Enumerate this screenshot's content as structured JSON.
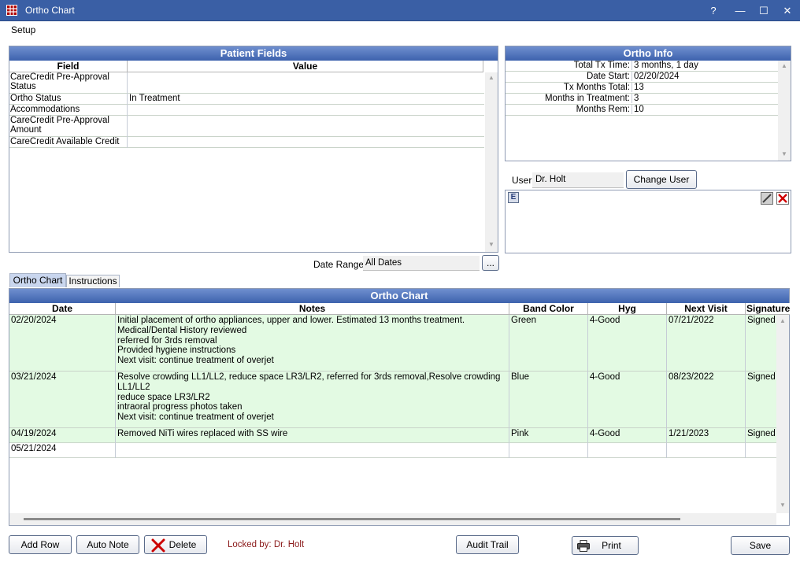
{
  "window": {
    "title": "Ortho Chart",
    "help": "?",
    "minimize": "—",
    "maximize": "☐",
    "close": "✕"
  },
  "menu": {
    "setup": "Setup"
  },
  "patient_fields": {
    "header": "Patient Fields",
    "col_field": "Field",
    "col_value": "Value",
    "rows": [
      {
        "field": "CareCredit Pre-Approval Status",
        "value": ""
      },
      {
        "field": "Ortho Status",
        "value": "In Treatment"
      },
      {
        "field": "Accommodations",
        "value": ""
      },
      {
        "field": "CareCredit Pre-Approval Amount",
        "value": ""
      },
      {
        "field": "CareCredit Available Credit",
        "value": ""
      }
    ]
  },
  "ortho_info": {
    "header": "Ortho Info",
    "rows": [
      {
        "label": "Total Tx Time:",
        "value": "3 months, 1 day"
      },
      {
        "label": "Date Start:",
        "value": "02/20/2024"
      },
      {
        "label": "Tx Months Total:",
        "value": "13"
      },
      {
        "label": "Months in Treatment:",
        "value": "3"
      },
      {
        "label": "Months Rem:",
        "value": "10"
      }
    ]
  },
  "user": {
    "label": "User",
    "value": "Dr. Holt",
    "change_button": "Change User"
  },
  "signature_box": {
    "e_icon": "E"
  },
  "date_range": {
    "label": "Date Range",
    "value": "All Dates",
    "button": "..."
  },
  "tabs": [
    {
      "label": "Ortho Chart",
      "active": true
    },
    {
      "label": "Instructions",
      "active": false
    }
  ],
  "ortho_chart": {
    "header": "Ortho Chart",
    "columns": [
      "Date",
      "Notes",
      "Band Color",
      "Hyg",
      "Next Visit",
      "Signature"
    ],
    "rows": [
      {
        "date": "02/20/2024",
        "notes": [
          "Initial placement of ortho appliances, upper and lower. Estimated 13 months treatment.",
          "Medical/Dental History reviewed",
          "referred for 3rds removal",
          "Provided hygiene instructions",
          "Next visit: continue treatment of overjet"
        ],
        "band": "Green",
        "hyg": "4-Good",
        "next": "07/21/2022",
        "sig": "Signed",
        "green": true
      },
      {
        "date": "03/21/2024",
        "notes": [
          "Resolve crowding LL1/LL2, reduce space LR3/LR2, referred for 3rds removal,Resolve crowding",
          "LL1/LL2",
          "reduce space LR3/LR2",
          "intraoral progress photos taken",
          "Next visit: continue treatment of overjet"
        ],
        "band": "Blue",
        "hyg": "4-Good",
        "next": "08/23/2022",
        "sig": "Signed",
        "green": true
      },
      {
        "date": "04/19/2024",
        "notes": [
          "Removed NiTi wires replaced with SS wire"
        ],
        "band": "Pink",
        "hyg": "4-Good",
        "next": "1/21/2023",
        "sig": "Signed",
        "green": true
      },
      {
        "date": "05/21/2024",
        "notes": [
          ""
        ],
        "band": "",
        "hyg": "",
        "next": "",
        "sig": "",
        "green": false
      }
    ]
  },
  "bottom": {
    "add_row": "Add Row",
    "auto_note": "Auto Note",
    "delete": "Delete",
    "locked": "Locked by: Dr. Holt",
    "audit_trail": "Audit Trail",
    "print": "Print",
    "save": "Save"
  },
  "colors": {
    "title_bar": "#3a5fa5",
    "panel_header": "#3d62ad",
    "row_green": "#e3fae3",
    "locked_text": "#8b1a1a",
    "delete_x": "#cc0000"
  }
}
